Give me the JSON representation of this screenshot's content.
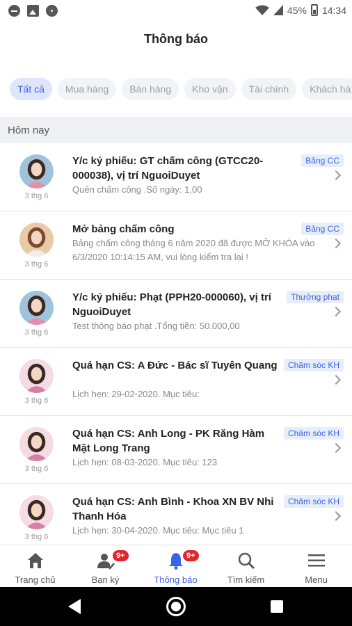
{
  "status_bar": {
    "battery": "45%",
    "time": "14:34"
  },
  "header": {
    "title": "Thông báo"
  },
  "filters": [
    "Tất cả",
    "Mua hàng",
    "Bán hàng",
    "Kho vận",
    "Tài chính",
    "Khách hà"
  ],
  "section": {
    "label": "Hôm nay"
  },
  "notifications": [
    {
      "title": "Y/c ký phiếu: GT chấm công (GTCC20-000038), vị trí NguoiDuyet",
      "desc": "Quên chấm công .Số ngày: 1,00",
      "tag": "Bảng CC",
      "date": "3 thg 6",
      "avatar": "woman-blue"
    },
    {
      "title": "Mở bảng chấm công",
      "desc": "Bảng chấm công tháng 6 năm 2020 đã được MỞ KHÓA vào 6/3/2020 10:14:15 AM, vui lòng kiểm tra lại !",
      "tag": "Bảng CC",
      "date": "3 thg 6",
      "avatar": "woman-brown"
    },
    {
      "title": "Y/c ký phiếu: Phạt (PPH20-000060), vị trí NguoiDuyet",
      "desc": "Test thông báo phạt .Tổng tiền: 50.000,00",
      "tag": "Thưởng phạt",
      "date": "3 thg 6",
      "avatar": "woman-blue"
    },
    {
      "title": "Quá hạn CS: A Đức - Bác sĩ Tuyên Quang",
      "desc": "Lịch hẹn: 29-02-2020. Mục tiêu:",
      "tag": "Chăm sóc KH",
      "date": "3 thg 6",
      "avatar": "woman-pink"
    },
    {
      "title": "Quá hạn CS: Anh Long - PK Răng Hàm Mặt Long Trang",
      "desc": "Lịch hẹn: 08-03-2020. Mục tiêu: 123",
      "tag": "Chăm sóc KH",
      "date": "3 thg 6",
      "avatar": "woman-pink"
    },
    {
      "title": "Quá hạn CS: Anh Bình - Khoa XN BV Nhi Thanh Hóa",
      "desc": "Lịch hẹn: 30-04-2020. Mục tiêu: Mục tiêu 1",
      "tag": "Chăm sóc KH",
      "date": "3 thg 6",
      "avatar": "woman-pink"
    }
  ],
  "tabs": [
    {
      "label": "Trang chủ",
      "icon": "home-icon",
      "badge": ""
    },
    {
      "label": "Bạn ký",
      "icon": "user-check-icon",
      "badge": "9+"
    },
    {
      "label": "Thông báo",
      "icon": "bell-icon",
      "badge": "9+"
    },
    {
      "label": "Tìm kiếm",
      "icon": "search-icon",
      "badge": ""
    },
    {
      "label": "Menu",
      "icon": "menu-icon",
      "badge": ""
    }
  ],
  "colors": {
    "accent": "#3a64e6",
    "badge": "#e0262b",
    "tag_bg": "#e8edfb"
  }
}
